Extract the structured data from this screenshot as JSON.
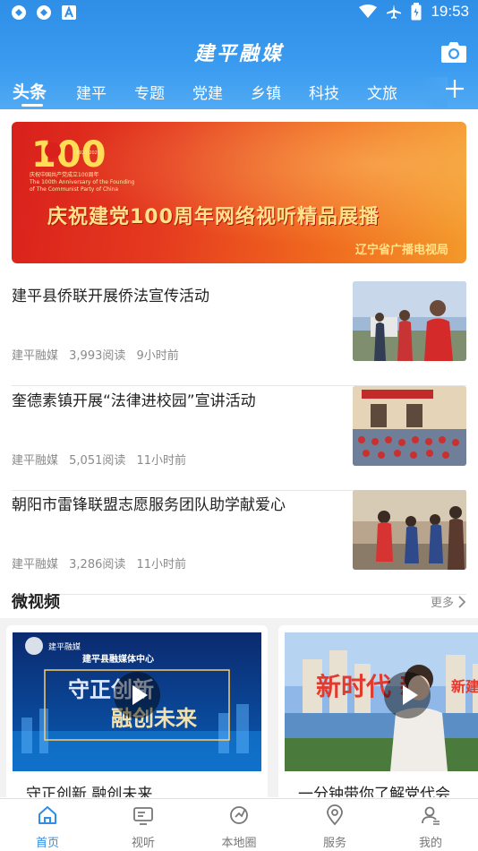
{
  "status_bar": {
    "time": "19:53"
  },
  "header": {
    "app_title": "建平融媒"
  },
  "tabs": [
    {
      "label": "头条",
      "active": true
    },
    {
      "label": "建平"
    },
    {
      "label": "专题"
    },
    {
      "label": "党建"
    },
    {
      "label": "乡镇"
    },
    {
      "label": "科技"
    },
    {
      "label": "文旅"
    }
  ],
  "banner": {
    "logo_number": "100",
    "logo_years": "1921 2021",
    "logo_caption_cn": "庆祝中国共产党成立100周年",
    "logo_caption_en": "The 100th Anniversary of the Founding of The Communist Party of China",
    "title": "庆祝建党100周年网络视听精品展播",
    "org": "辽宁省广播电视局"
  },
  "news": [
    {
      "title": "建平县侨联开展侨法宣传活动",
      "source": "建平融媒",
      "reads": "3,993阅读",
      "time": "9小时前"
    },
    {
      "title": "奎德素镇开展“法律进校园”宣讲活动",
      "source": "建平融媒",
      "reads": "5,051阅读",
      "time": "11小时前"
    },
    {
      "title": "朝阳市雷锋联盟志愿服务团队助学献爱心",
      "source": "建平融媒",
      "reads": "3,286阅读",
      "time": "11小时前"
    }
  ],
  "section": {
    "title": "微视频",
    "more": "更多"
  },
  "videos": [
    {
      "title": "守正创新 融创未来",
      "thumb_header": "建平县融媒体中心",
      "thumb_line1": "守正创新",
      "thumb_line2": "融创未来",
      "thumb_logo": "建平融媒"
    },
    {
      "title": "一分钟带你了解党代会",
      "thumb_text": "新时代 新",
      "thumb_text2": "新建平"
    }
  ],
  "bottom_nav": [
    {
      "label": "首页",
      "icon": "home-icon",
      "active": true
    },
    {
      "label": "视听",
      "icon": "tv-icon"
    },
    {
      "label": "本地圈",
      "icon": "local-circle-icon"
    },
    {
      "label": "服务",
      "icon": "location-pin-icon"
    },
    {
      "label": "我的",
      "icon": "profile-icon"
    }
  ],
  "colors": {
    "brand_blue": "#2f8ee6",
    "banner_red": "#d9201c",
    "banner_gold": "#ffe38a"
  }
}
